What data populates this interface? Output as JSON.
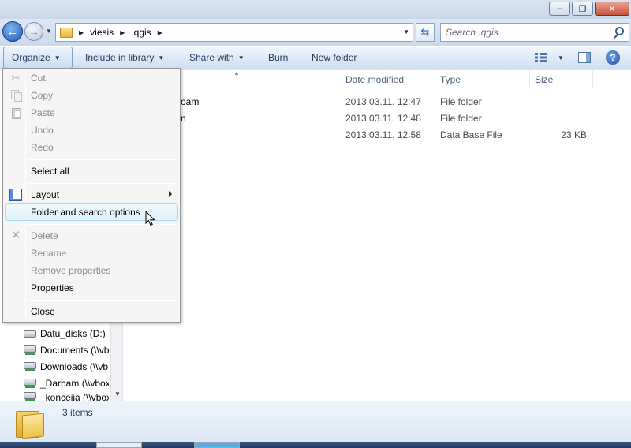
{
  "address": {
    "crumbs": [
      "viesis",
      ".qgis"
    ]
  },
  "search": {
    "placeholder": "Search .qgis"
  },
  "toolbar": {
    "organize": "Organize",
    "include_in_library": "Include in library",
    "share_with": "Share with",
    "burn": "Burn",
    "new_folder": "New folder"
  },
  "columns": {
    "date_modified": "Date modified",
    "type": "Type",
    "size": "Size"
  },
  "files": [
    {
      "name_fragment": "oam",
      "date": "2013.03.11. 12:47",
      "type": "File folder",
      "size": ""
    },
    {
      "name_fragment": "n",
      "date": "2013.03.11. 12:48",
      "type": "File folder",
      "size": ""
    },
    {
      "name_fragment": "",
      "date": "2013.03.11. 12:58",
      "type": "Data Base File",
      "size": "23 KB"
    }
  ],
  "nav_items": [
    {
      "label": "Datu_disks (D:)",
      "icon": "drive-icon"
    },
    {
      "label": "Documents (\\\\vb",
      "icon": "network-drive-icon"
    },
    {
      "label": "Downloads (\\\\vb",
      "icon": "network-drive-icon"
    },
    {
      "label": "_Darbam (\\\\vbox",
      "icon": "network-drive-icon"
    },
    {
      "label": "_koncejja (\\\\vbox",
      "icon": "network-drive-icon"
    }
  ],
  "menu": {
    "cut": "Cut",
    "copy": "Copy",
    "paste": "Paste",
    "undo": "Undo",
    "redo": "Redo",
    "select_all": "Select all",
    "layout": "Layout",
    "folder_options": "Folder and search options",
    "delete": "Delete",
    "rename": "Rename",
    "remove_properties": "Remove properties",
    "properties": "Properties",
    "close": "Close"
  },
  "status": {
    "items": "3 items"
  }
}
